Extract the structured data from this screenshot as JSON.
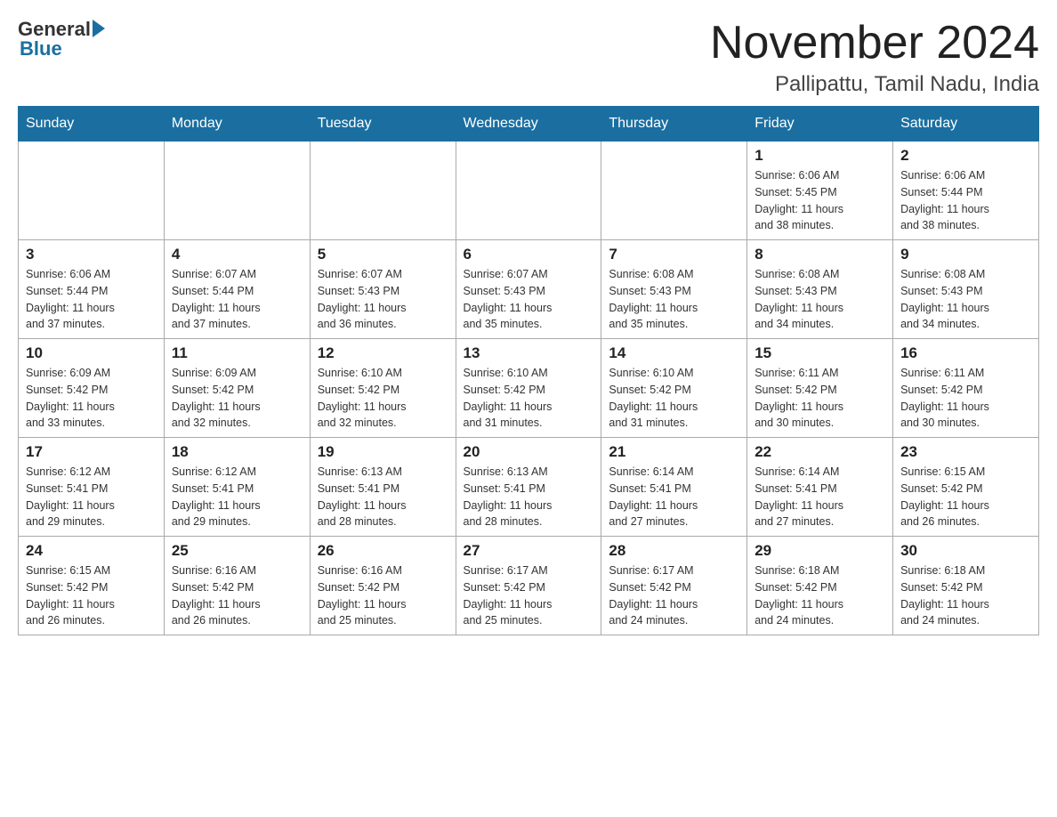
{
  "header": {
    "logo_general": "General",
    "logo_blue": "Blue",
    "month_title": "November 2024",
    "location": "Pallipattu, Tamil Nadu, India"
  },
  "weekdays": [
    "Sunday",
    "Monday",
    "Tuesday",
    "Wednesday",
    "Thursday",
    "Friday",
    "Saturday"
  ],
  "weeks": [
    [
      {
        "day": "",
        "info": ""
      },
      {
        "day": "",
        "info": ""
      },
      {
        "day": "",
        "info": ""
      },
      {
        "day": "",
        "info": ""
      },
      {
        "day": "",
        "info": ""
      },
      {
        "day": "1",
        "info": "Sunrise: 6:06 AM\nSunset: 5:45 PM\nDaylight: 11 hours\nand 38 minutes."
      },
      {
        "day": "2",
        "info": "Sunrise: 6:06 AM\nSunset: 5:44 PM\nDaylight: 11 hours\nand 38 minutes."
      }
    ],
    [
      {
        "day": "3",
        "info": "Sunrise: 6:06 AM\nSunset: 5:44 PM\nDaylight: 11 hours\nand 37 minutes."
      },
      {
        "day": "4",
        "info": "Sunrise: 6:07 AM\nSunset: 5:44 PM\nDaylight: 11 hours\nand 37 minutes."
      },
      {
        "day": "5",
        "info": "Sunrise: 6:07 AM\nSunset: 5:43 PM\nDaylight: 11 hours\nand 36 minutes."
      },
      {
        "day": "6",
        "info": "Sunrise: 6:07 AM\nSunset: 5:43 PM\nDaylight: 11 hours\nand 35 minutes."
      },
      {
        "day": "7",
        "info": "Sunrise: 6:08 AM\nSunset: 5:43 PM\nDaylight: 11 hours\nand 35 minutes."
      },
      {
        "day": "8",
        "info": "Sunrise: 6:08 AM\nSunset: 5:43 PM\nDaylight: 11 hours\nand 34 minutes."
      },
      {
        "day": "9",
        "info": "Sunrise: 6:08 AM\nSunset: 5:43 PM\nDaylight: 11 hours\nand 34 minutes."
      }
    ],
    [
      {
        "day": "10",
        "info": "Sunrise: 6:09 AM\nSunset: 5:42 PM\nDaylight: 11 hours\nand 33 minutes."
      },
      {
        "day": "11",
        "info": "Sunrise: 6:09 AM\nSunset: 5:42 PM\nDaylight: 11 hours\nand 32 minutes."
      },
      {
        "day": "12",
        "info": "Sunrise: 6:10 AM\nSunset: 5:42 PM\nDaylight: 11 hours\nand 32 minutes."
      },
      {
        "day": "13",
        "info": "Sunrise: 6:10 AM\nSunset: 5:42 PM\nDaylight: 11 hours\nand 31 minutes."
      },
      {
        "day": "14",
        "info": "Sunrise: 6:10 AM\nSunset: 5:42 PM\nDaylight: 11 hours\nand 31 minutes."
      },
      {
        "day": "15",
        "info": "Sunrise: 6:11 AM\nSunset: 5:42 PM\nDaylight: 11 hours\nand 30 minutes."
      },
      {
        "day": "16",
        "info": "Sunrise: 6:11 AM\nSunset: 5:42 PM\nDaylight: 11 hours\nand 30 minutes."
      }
    ],
    [
      {
        "day": "17",
        "info": "Sunrise: 6:12 AM\nSunset: 5:41 PM\nDaylight: 11 hours\nand 29 minutes."
      },
      {
        "day": "18",
        "info": "Sunrise: 6:12 AM\nSunset: 5:41 PM\nDaylight: 11 hours\nand 29 minutes."
      },
      {
        "day": "19",
        "info": "Sunrise: 6:13 AM\nSunset: 5:41 PM\nDaylight: 11 hours\nand 28 minutes."
      },
      {
        "day": "20",
        "info": "Sunrise: 6:13 AM\nSunset: 5:41 PM\nDaylight: 11 hours\nand 28 minutes."
      },
      {
        "day": "21",
        "info": "Sunrise: 6:14 AM\nSunset: 5:41 PM\nDaylight: 11 hours\nand 27 minutes."
      },
      {
        "day": "22",
        "info": "Sunrise: 6:14 AM\nSunset: 5:41 PM\nDaylight: 11 hours\nand 27 minutes."
      },
      {
        "day": "23",
        "info": "Sunrise: 6:15 AM\nSunset: 5:42 PM\nDaylight: 11 hours\nand 26 minutes."
      }
    ],
    [
      {
        "day": "24",
        "info": "Sunrise: 6:15 AM\nSunset: 5:42 PM\nDaylight: 11 hours\nand 26 minutes."
      },
      {
        "day": "25",
        "info": "Sunrise: 6:16 AM\nSunset: 5:42 PM\nDaylight: 11 hours\nand 26 minutes."
      },
      {
        "day": "26",
        "info": "Sunrise: 6:16 AM\nSunset: 5:42 PM\nDaylight: 11 hours\nand 25 minutes."
      },
      {
        "day": "27",
        "info": "Sunrise: 6:17 AM\nSunset: 5:42 PM\nDaylight: 11 hours\nand 25 minutes."
      },
      {
        "day": "28",
        "info": "Sunrise: 6:17 AM\nSunset: 5:42 PM\nDaylight: 11 hours\nand 24 minutes."
      },
      {
        "day": "29",
        "info": "Sunrise: 6:18 AM\nSunset: 5:42 PM\nDaylight: 11 hours\nand 24 minutes."
      },
      {
        "day": "30",
        "info": "Sunrise: 6:18 AM\nSunset: 5:42 PM\nDaylight: 11 hours\nand 24 minutes."
      }
    ]
  ]
}
